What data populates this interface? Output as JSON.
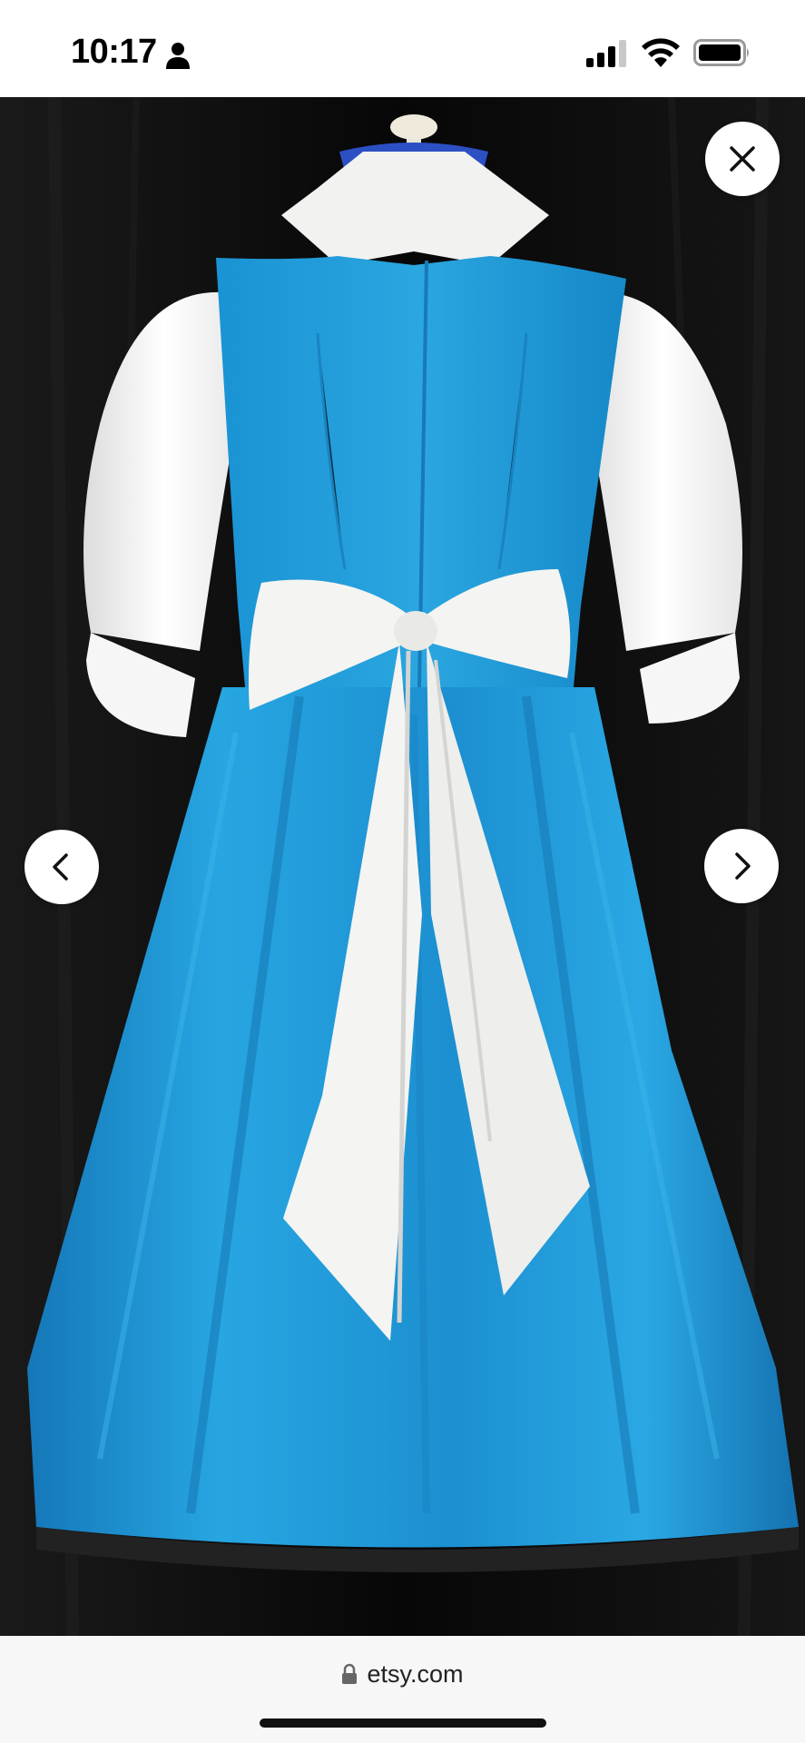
{
  "status_bar": {
    "time": "10:17",
    "icons": [
      "person-icon",
      "cellular-signal-icon",
      "wifi-icon",
      "battery-icon"
    ]
  },
  "viewer": {
    "image_description_icons": [
      "close-icon",
      "chevron-left-icon",
      "chevron-right-icon"
    ],
    "colors": {
      "background": "#0b0b0b",
      "dress_blue": "#1f9ad6",
      "sash_white": "#f4f4f2"
    }
  },
  "address_bar": {
    "url": "etsy.com",
    "icon": "lock-icon"
  }
}
